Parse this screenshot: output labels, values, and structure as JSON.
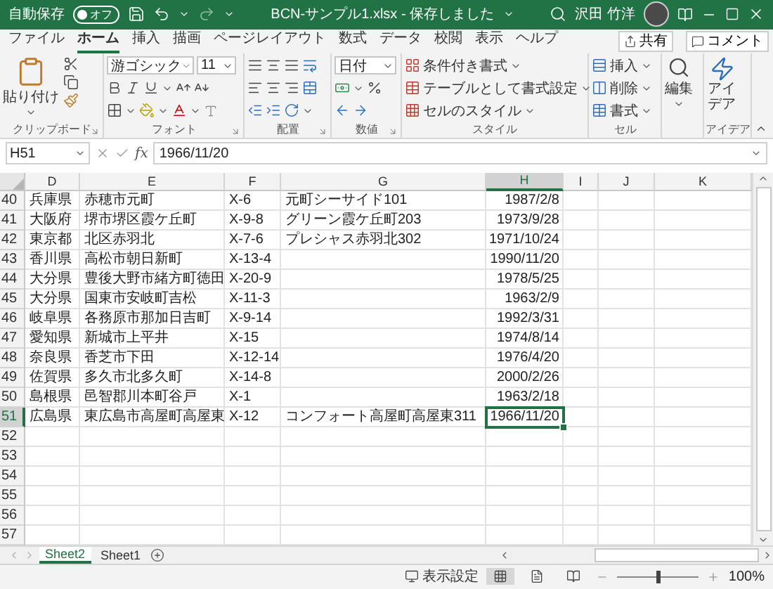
{
  "title_bar": {
    "autosave_label": "自動保存",
    "autosave_on": false,
    "autosave_state": "オフ",
    "title": "BCN-サンプル1.xlsx - 保存しました",
    "user": "沢田 竹洋"
  },
  "tabs": [
    {
      "label": "ファイル",
      "selected": false
    },
    {
      "label": "ホーム",
      "selected": true
    },
    {
      "label": "挿入",
      "selected": false
    },
    {
      "label": "描画",
      "selected": false
    },
    {
      "label": "ページレイアウト",
      "selected": false
    },
    {
      "label": "数式",
      "selected": false
    },
    {
      "label": "データ",
      "selected": false
    },
    {
      "label": "校閲",
      "selected": false
    },
    {
      "label": "表示",
      "selected": false
    },
    {
      "label": "ヘルプ",
      "selected": false
    }
  ],
  "share_button": "共有",
  "comment_button": "コメント",
  "ribbon": [
    {
      "kind": "clipboard",
      "label": "クリップボード",
      "paste": "貼り付け"
    },
    {
      "kind": "font",
      "label": "フォント",
      "font_name": "游ゴシック",
      "font_size": "11"
    },
    {
      "kind": "alignment",
      "label": "配置"
    },
    {
      "kind": "number",
      "label": "数値",
      "format": "日付"
    },
    {
      "kind": "styles",
      "label": "スタイル",
      "items": [
        "条件付き書式",
        "テーブルとして書式設定",
        "セルのスタイル"
      ]
    },
    {
      "kind": "cells",
      "label": "セル",
      "items": [
        "挿入",
        "削除",
        "書式"
      ]
    },
    {
      "kind": "editing",
      "button": "編集"
    },
    {
      "kind": "ideas",
      "label": "アイデア",
      "button": "アイデア"
    }
  ],
  "formula_bar": {
    "name_box": "H51",
    "fx": "fx",
    "value": "1966/11/20"
  },
  "columns": [
    {
      "label": "D",
      "selected": false
    },
    {
      "label": "E",
      "selected": false
    },
    {
      "label": "F",
      "selected": false
    },
    {
      "label": "G",
      "selected": false
    },
    {
      "label": "H",
      "selected": true
    },
    {
      "label": "I",
      "selected": false
    },
    {
      "label": "J",
      "selected": false
    },
    {
      "label": "K",
      "selected": false
    }
  ],
  "rows": [
    {
      "number": "40",
      "selected": false,
      "cells": [
        "兵庫県",
        "赤穂市元町",
        "X-6",
        "元町シーサイド101",
        "1987/2/8"
      ]
    },
    {
      "number": "41",
      "selected": false,
      "cells": [
        "大阪府",
        "堺市堺区霞ケ丘町",
        "X-9-8",
        "グリーン霞ケ丘町203",
        "1973/9/28"
      ]
    },
    {
      "number": "42",
      "selected": false,
      "cells": [
        "東京都",
        "北区赤羽北",
        "X-7-6",
        "プレシャス赤羽北302",
        "1971/10/24"
      ]
    },
    {
      "number": "43",
      "selected": false,
      "cells": [
        "香川県",
        "高松市朝日新町",
        "X-13-4",
        null,
        "1990/11/20"
      ]
    },
    {
      "number": "44",
      "selected": false,
      "cells": [
        "大分県",
        "豊後大野市緒方町徳田",
        "X-20-9",
        null,
        "1978/5/25"
      ]
    },
    {
      "number": "45",
      "selected": false,
      "cells": [
        "大分県",
        "国東市安岐町吉松",
        "X-11-3",
        null,
        "1963/2/9"
      ]
    },
    {
      "number": "46",
      "selected": false,
      "cells": [
        "岐阜県",
        "各務原市那加日吉町",
        "X-9-14",
        null,
        "1992/3/31"
      ]
    },
    {
      "number": "47",
      "selected": false,
      "cells": [
        "愛知県",
        "新城市上平井",
        "X-15",
        null,
        "1974/8/14"
      ]
    },
    {
      "number": "48",
      "selected": false,
      "cells": [
        "奈良県",
        "香芝市下田",
        "X-12-14",
        null,
        "1976/4/20"
      ]
    },
    {
      "number": "49",
      "selected": false,
      "cells": [
        "佐賀県",
        "多久市北多久町",
        "X-14-8",
        null,
        "2000/2/26"
      ]
    },
    {
      "number": "50",
      "selected": false,
      "cells": [
        "島根県",
        "邑智郡川本町谷戸",
        "X-1",
        null,
        "1963/2/18"
      ]
    },
    {
      "number": "51",
      "selected": true,
      "cells": [
        "広島県",
        "東広島市高屋町高屋東",
        "X-12",
        "コンフォート高屋町高屋東311",
        "1966/11/20"
      ]
    },
    {
      "number": "52",
      "selected": false,
      "cells": []
    },
    {
      "number": "53",
      "selected": false,
      "cells": []
    },
    {
      "number": "54",
      "selected": false,
      "cells": []
    },
    {
      "number": "55",
      "selected": false,
      "cells": []
    },
    {
      "number": "56",
      "selected": false,
      "cells": []
    },
    {
      "number": "57",
      "selected": false,
      "cells": []
    }
  ],
  "sheet_tabs": [
    {
      "label": "Sheet2",
      "selected": true
    },
    {
      "label": "Sheet1",
      "selected": false
    }
  ],
  "status_bar": {
    "display_settings": "表示設定",
    "zoom": "100%",
    "zoom_slider": {
      "level": 0.5
    }
  }
}
